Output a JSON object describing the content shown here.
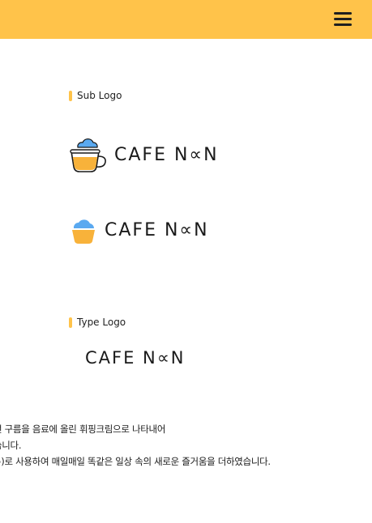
{
  "header": {
    "menu_icon": "hamburger-menu-icon",
    "color": "#ffc34a"
  },
  "sections": {
    "sub_logo_label": "Sub Logo",
    "type_logo_label": "Type Logo"
  },
  "logos": {
    "cup_logo_text": "CAFE N∝N",
    "cloud_logo_text": "CAFE N∝N",
    "type_logo_text": "CAFE N∝N"
  },
  "description": {
    "line1": "런 구름을 음료에 올린 휘핑크림으로 나타내어",
    "line2": "습니다.",
    "line3": "∞)로 사용하여 매일매일 똑같은 일상 속의 새로운 즐거움을 더하였습니다."
  },
  "colors": {
    "accent": "#ffc34a",
    "cloud": "#5aa9f0",
    "cup_fill": "#f8b23a",
    "text": "#1a1a1a"
  }
}
